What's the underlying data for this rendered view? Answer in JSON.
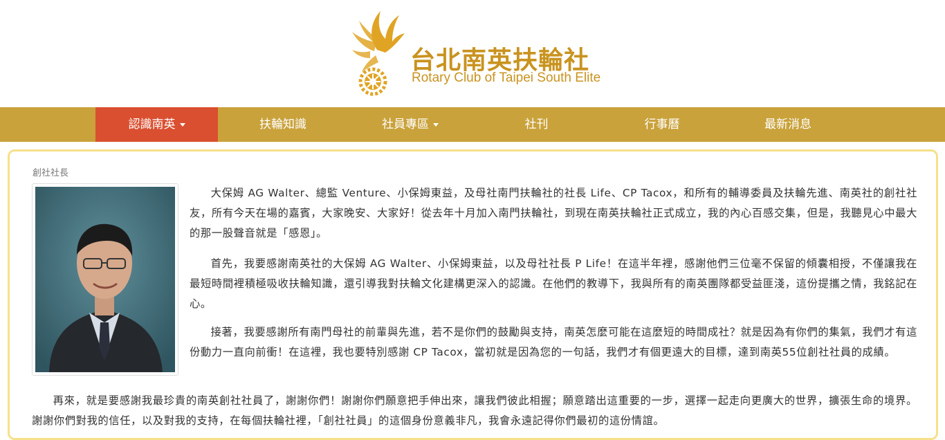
{
  "site": {
    "title_cn": "台北南英扶輪社",
    "title_en": "Rotary Club of Taipei South Elite"
  },
  "nav": {
    "items": [
      {
        "label": "認識南英",
        "dropdown": true,
        "active": true
      },
      {
        "label": "扶輪知識",
        "dropdown": false,
        "active": false
      },
      {
        "label": "社員專區",
        "dropdown": true,
        "active": false
      },
      {
        "label": "社刊",
        "dropdown": false,
        "active": false
      },
      {
        "label": "行事曆",
        "dropdown": false,
        "active": false
      },
      {
        "label": "最新消息",
        "dropdown": false,
        "active": false
      }
    ]
  },
  "colors": {
    "brand_gold": "#c9a23b",
    "logo_gold": "#c9931f",
    "active_red": "#d94f30",
    "panel_border": "#f6e08a"
  },
  "icons": {
    "logo": "phoenix-rotary-wheel-icon",
    "dropdown": "caret-down-icon"
  },
  "content": {
    "section_title": "創社社長",
    "paragraphs": [
      "大保姆 AG Walter、總監 Venture、小保姆東益，及母社南門扶輪社的社長 Life、CP Tacox，和所有的輔導委員及扶輪先進、南英社的創社社友，所有今天在場的嘉賓，大家晚安、大家好！從去年十月加入南門扶輪社，到現在南英扶輪社正式成立，我的內心百感交集，但是，我聽見心中最大的那一股聲音就是「感恩」。",
      "首先，我要感謝南英社的大保姆 AG Walter、小保姆東益，以及母社社長 P Life！在這半年裡，感謝他們三位毫不保留的傾囊相授，不僅讓我在最短時間裡積極吸收扶輪知識，還引導我對扶輪文化建構更深入的認識。在他們的教導下，我與所有的南英團隊都受益匪淺，這份提攜之情，我銘記在心。",
      "接著，我要感謝所有南門母社的前輩與先進，若不是你們的鼓勵與支持，南英怎麼可能在這麼短的時間成社？就是因為有你們的集氣，我們才有這份動力一直向前衝！在這裡，我也要特別感謝 CP Tacox，當初就是因為您的一句話，我們才有個更遠大的目標，達到南英55位創社社員的成績。",
      "再來，就是要感謝我最珍貴的南英創社社員了，謝謝你們！謝謝你們願意把手伸出來，讓我們彼此相握；願意踏出這重要的一步，選擇一起走向更廣大的世界，擴張生命的境界。謝謝你們對我的信任，以及對我的支持，在每個扶輪社裡，「創社社員」的這個身份意義非凡，我會永遠記得你們最初的這份情誼。"
    ]
  }
}
